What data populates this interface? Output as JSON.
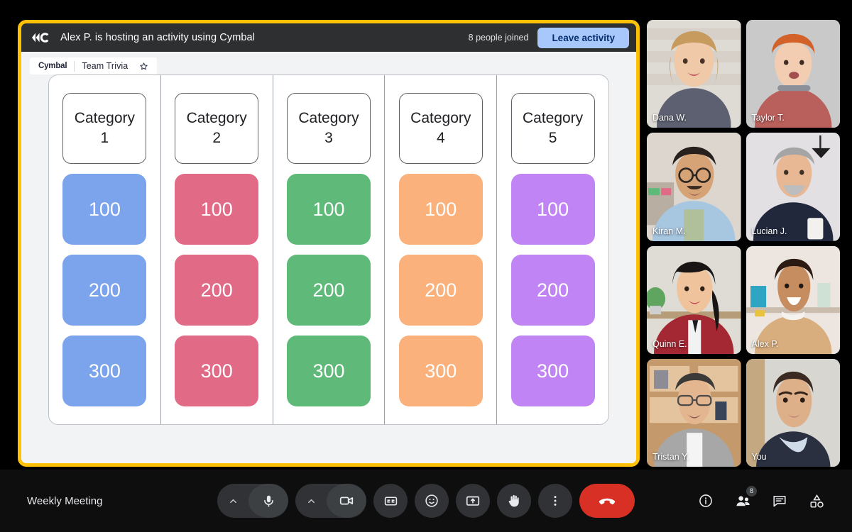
{
  "meeting": {
    "title": "Weekly Meeting"
  },
  "activity": {
    "host_banner": "Alex P. is hosting an activity using Cymbal",
    "logo_name": "cymbal-logo",
    "joined_count_label": "8 people joined",
    "leave_label": "Leave activity",
    "accent_border": "#FFC107",
    "leave_button_bg": "#A8C7FA",
    "app": {
      "brand": "Cymbal",
      "tab_title": "Team Trivia",
      "star_icon": "star-outline-icon"
    }
  },
  "board": {
    "columns": [
      {
        "category": "Category 1",
        "color": "#7BA4EC",
        "tiles": [
          "100",
          "200",
          "300"
        ]
      },
      {
        "category": "Category 2",
        "color": "#E16B87",
        "tiles": [
          "100",
          "200",
          "300"
        ]
      },
      {
        "category": "Category 3",
        "color": "#5FBA79",
        "tiles": [
          "100",
          "200",
          "300"
        ]
      },
      {
        "category": "Category 4",
        "color": "#FBB17B",
        "tiles": [
          "100",
          "200",
          "300"
        ]
      },
      {
        "category": "Category 5",
        "color": "#C084F5",
        "tiles": [
          "100",
          "200",
          "300"
        ]
      }
    ]
  },
  "participants": [
    {
      "name": "Dana W.",
      "self": false
    },
    {
      "name": "Taylor T.",
      "self": false
    },
    {
      "name": "Kiran M.",
      "self": false
    },
    {
      "name": "Lucian J.",
      "self": false
    },
    {
      "name": "Quinn E.",
      "self": false
    },
    {
      "name": "Alex P.",
      "self": false
    },
    {
      "name": "Tristan Y.",
      "self": false
    },
    {
      "name": "You",
      "self": true
    }
  ],
  "toolbar": {
    "mic": "microphone-icon",
    "mic_chevron": "chevron-up-icon",
    "camera": "video-camera-icon",
    "camera_chevron": "chevron-up-icon",
    "captions": "closed-captions-icon",
    "emoji": "emoji-reaction-icon",
    "present": "present-screen-icon",
    "raise_hand": "raise-hand-icon",
    "more": "more-options-icon",
    "hangup": "end-call-icon"
  },
  "right_toolbar": {
    "info": "info-icon",
    "people": "people-icon",
    "people_badge": "8",
    "chat": "chat-icon",
    "activities": "activities-icon"
  }
}
